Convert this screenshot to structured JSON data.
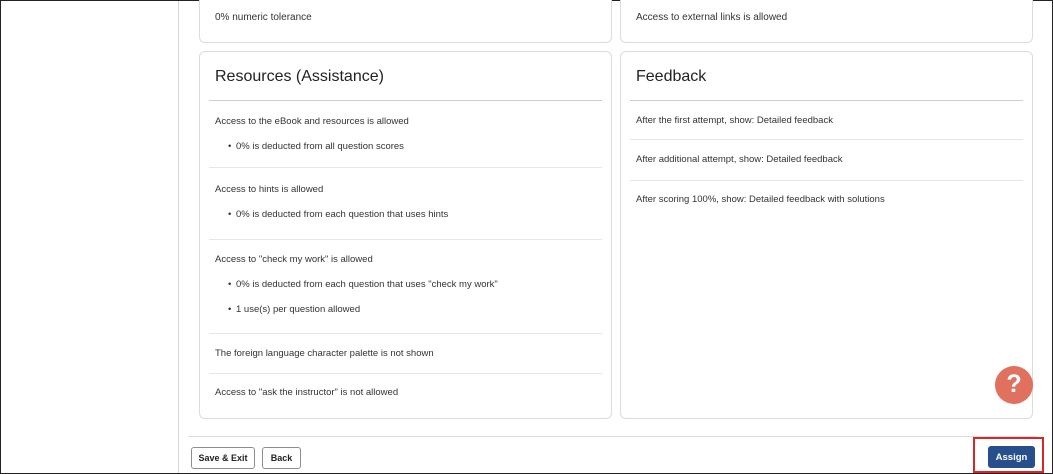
{
  "top_cards": {
    "left_text": "0% numeric tolerance",
    "right_text": "Access to external links is allowed"
  },
  "resources": {
    "title": "Resources (Assistance)",
    "ebook": {
      "text": "Access to the eBook and resources is allowed",
      "bullets": [
        "0% is deducted from all question scores"
      ]
    },
    "hints": {
      "text": "Access to hints is allowed",
      "bullets": [
        "0% is deducted from each question that uses hints"
      ]
    },
    "check_my_work": {
      "text": "Access to \"check my work\" is allowed",
      "bullets": [
        "0% is deducted from each question that uses \"check my work\"",
        "1 use(s) per question allowed"
      ]
    },
    "palette_text": "The foreign language character palette is not shown",
    "ask_instructor_text": "Access to \"ask the instructor\" is not allowed"
  },
  "feedback": {
    "title": "Feedback",
    "items": [
      "After the first attempt, show: Detailed feedback",
      "After additional attempt, show: Detailed feedback",
      "After scoring 100%, show: Detailed feedback with solutions"
    ]
  },
  "help": {
    "icon": "question-mark-icon",
    "glyph": "?",
    "color": "#e0715f"
  },
  "footer": {
    "save_exit_label": "Save & Exit",
    "back_label": "Back",
    "assign_label": "Assign"
  },
  "colors": {
    "assign_button": "#264f8c",
    "highlight_border": "#d62828"
  }
}
